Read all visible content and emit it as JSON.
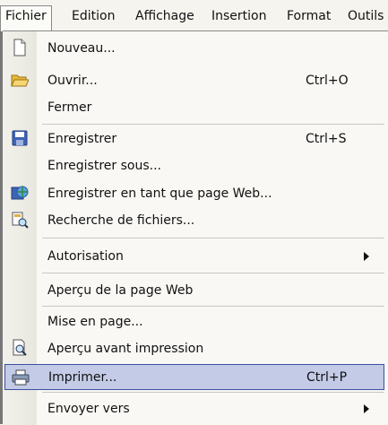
{
  "menubar": {
    "items": [
      "Fichier",
      "Edition",
      "Affichage",
      "Insertion",
      "Format",
      "Outils"
    ]
  },
  "menu": {
    "items": [
      {
        "label": "Nouveau...",
        "shortcut": "",
        "icon": "new-document-icon"
      },
      {
        "label": "Ouvrir...",
        "shortcut": "Ctrl+O",
        "icon": "open-folder-icon"
      },
      {
        "label": "Fermer",
        "shortcut": "",
        "icon": ""
      },
      {
        "label": "Enregistrer",
        "shortcut": "Ctrl+S",
        "icon": "save-icon"
      },
      {
        "label": "Enregistrer sous...",
        "shortcut": "",
        "icon": ""
      },
      {
        "label": "Enregistrer en tant que page Web...",
        "shortcut": "",
        "icon": "save-web-icon"
      },
      {
        "label": "Recherche de fichiers...",
        "shortcut": "",
        "icon": "file-search-icon"
      },
      {
        "label": "Autorisation",
        "shortcut": "",
        "icon": "",
        "submenu": true
      },
      {
        "label": "Aperçu de la page Web",
        "shortcut": "",
        "icon": ""
      },
      {
        "label": "Mise en page...",
        "shortcut": "",
        "icon": ""
      },
      {
        "label": "Aperçu avant impression",
        "shortcut": "",
        "icon": "print-preview-icon"
      },
      {
        "label": "Imprimer...",
        "shortcut": "Ctrl+P",
        "icon": "printer-icon",
        "highlighted": true
      },
      {
        "label": "Envoyer vers",
        "shortcut": "",
        "icon": "",
        "submenu": true
      }
    ]
  },
  "colors": {
    "highlight_fill": "#c3cbe6",
    "highlight_border": "#3d4fa0",
    "menu_background": "#f9f8f5"
  }
}
